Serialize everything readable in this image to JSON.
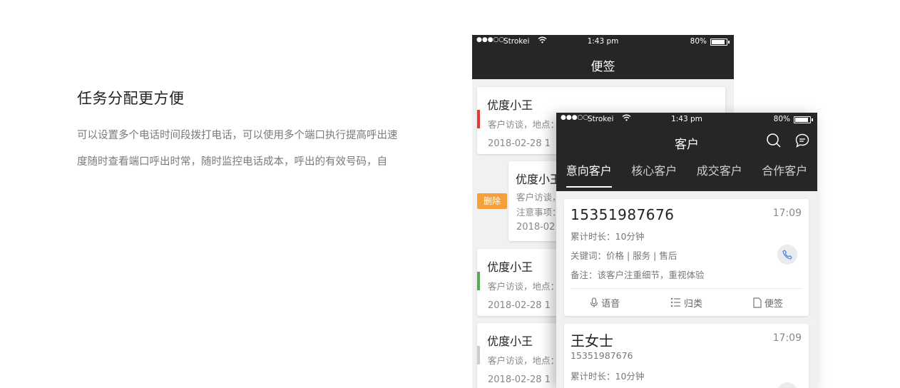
{
  "intro": {
    "heading": "任务分配更方便",
    "description": "可以设置多个电话时间段拨打电话，可以使用多个端口执行提高呼出速度随时查看端口呼出时常，随时监控电话成本，呼出的有效号码，自"
  },
  "colors": {
    "dark_bar": "#262626",
    "red_mark": "#e53935",
    "green_mark": "#4caf50",
    "gray_mark": "#cccccc",
    "delete": "#f5a03a",
    "call_icon": "#4a8de8"
  },
  "back_phone": {
    "status": {
      "dots": "●●●○○",
      "carrier": "Strokei",
      "time": "1:43 pm",
      "battery": "80%"
    },
    "title": "便签",
    "delete_label": "删除",
    "notes": [
      {
        "title": "优度小王",
        "line1": "客户访谈，地点：",
        "date": "2018-02-28  1"
      },
      {
        "title": "优度小王",
        "line1": "客户访谈，",
        "line2": "注意事项：",
        "date": "2018-02"
      },
      {
        "title": "优度小王",
        "line1": "客户访谈，地点：",
        "date": "2018-02-28  1"
      },
      {
        "title": "优度小王",
        "line1": "客户访谈，地点：",
        "date": "2018-02-28  1"
      }
    ]
  },
  "front_phone": {
    "status": {
      "dots": "●●●○○",
      "carrier": "Strokei",
      "time": "1:43 pm",
      "battery": "80%"
    },
    "title": "客户",
    "icons": [
      "search-icon",
      "chat-icon",
      "microphone-icon",
      "list-icon",
      "note-icon",
      "phone-icon"
    ],
    "tabs": [
      "意向客户",
      "核心客户",
      "成交客户",
      "合作客户"
    ],
    "customers": [
      {
        "phone": "15351987676",
        "time": "17:09",
        "duration": "累计时长：10分钟",
        "keywords": "关键词：价格 | 服务 | 售后",
        "remark": "备注：该客户注重细节，重视体验",
        "actions": {
          "voice": "语音",
          "category": "归类",
          "note": "便签"
        }
      },
      {
        "name": "王女士",
        "time": "17:09",
        "phone": "15351987676",
        "duration": "累计时长：10分钟"
      }
    ]
  }
}
